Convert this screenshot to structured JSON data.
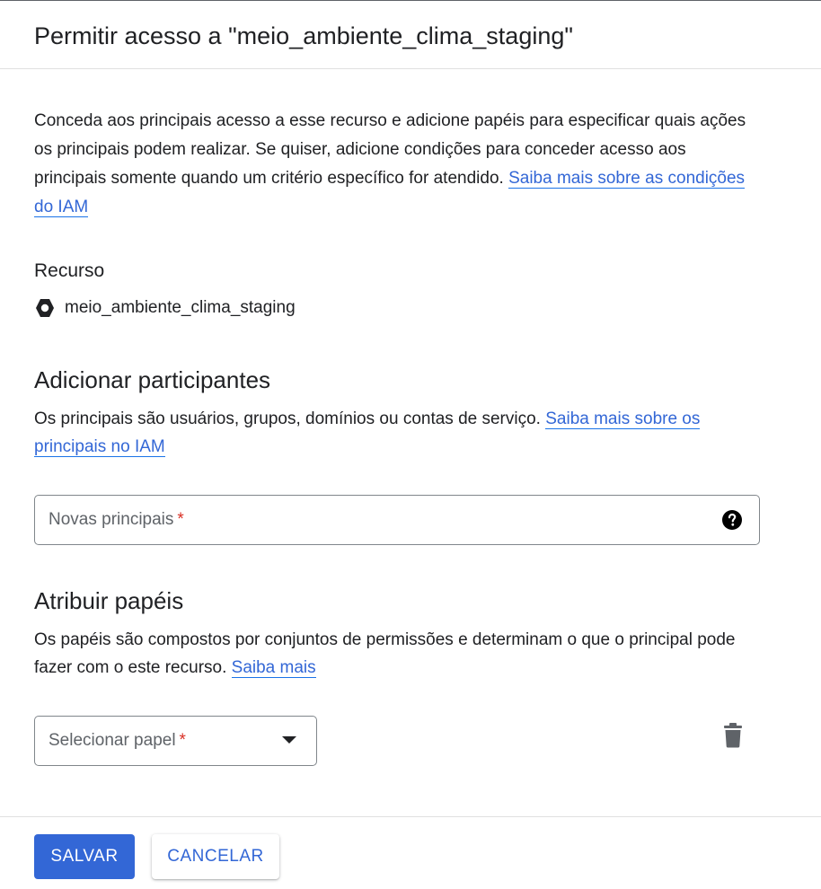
{
  "dialog": {
    "title": "Permitir acesso a \"meio_ambiente_clima_staging\""
  },
  "intro": {
    "text": "Conceda aos principais acesso a esse recurso e adicione papéis para especificar quais ações os principais podem realizar. Se quiser, adicione condições para conceder acesso aos principais somente quando um critério específico for atendido. ",
    "link": "Saiba mais sobre as condições do IAM"
  },
  "resource": {
    "label": "Recurso",
    "name": "meio_ambiente_clima_staging",
    "icon": "bigquery-dataset-icon"
  },
  "add_principals": {
    "heading": "Adicionar participantes",
    "description": "Os principais são usuários, grupos, domínios ou contas de serviço. ",
    "link": "Saiba mais sobre os principais no IAM",
    "field_label": "Novas principais",
    "required_mark": "*",
    "help_icon": "help-circle-icon"
  },
  "assign_roles": {
    "heading": "Atribuir papéis",
    "description": "Os papéis são compostos por conjuntos de permissões e determinam o que o principal pode fazer com o este recurso. ",
    "link": "Saiba mais",
    "select_label": "Selecionar papel",
    "required_mark": "*",
    "delete_icon": "trash-icon"
  },
  "footer": {
    "save_label": "SALVAR",
    "cancel_label": "CANCELAR"
  },
  "colors": {
    "primary": "#3367d6",
    "required": "#d93025",
    "text": "#202124"
  }
}
